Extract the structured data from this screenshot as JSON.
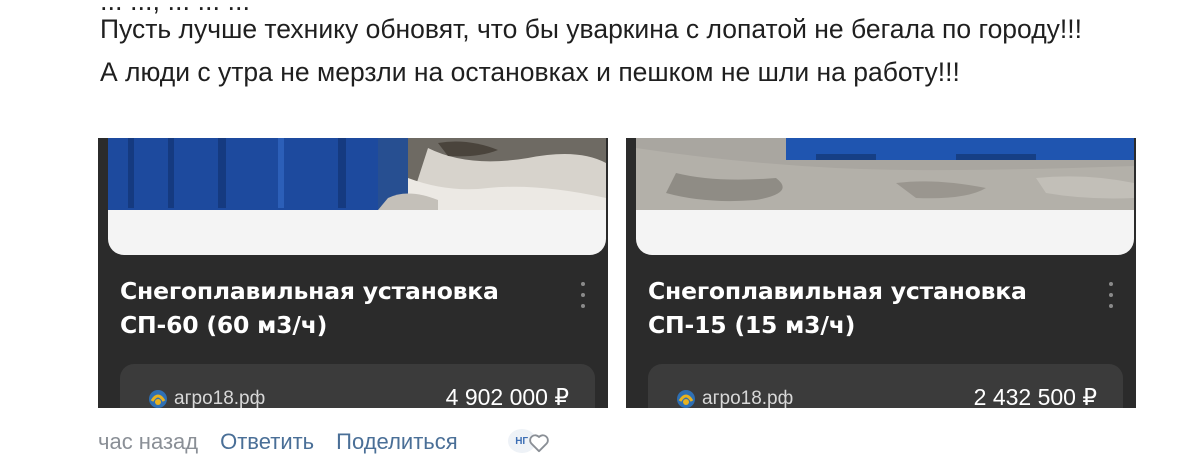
{
  "comment": {
    "cut_line": "... ..., ... ... ...",
    "text": "Пусть лучше технику обновят, что бы уваркина с лопатой не бегала по городу!!! А люди с утра не мерзли на остановках и пешком не шли на работу!!!"
  },
  "ads": [
    {
      "title": "Снегоплавильная установка СП-60 (60 м3/ч)",
      "site": "агро18.рф",
      "price": "4 902 000 ₽"
    },
    {
      "title": "Снегоплавильная установка СП-15 (15 м3/ч)",
      "site": "агро18.рф",
      "price": "2 432 500 ₽"
    }
  ],
  "actions": {
    "time": "час назад",
    "reply": "Ответить",
    "share": "Поделиться",
    "badge": "НГ"
  },
  "icons": {
    "menu": "more-vertical-icon",
    "like": "heart-icon",
    "site_logo": "site-logo-icon"
  },
  "colors": {
    "card_bg": "#2b2b2b",
    "price_bg": "#3b3b3b",
    "link": "#4a6f97",
    "muted": "#8a8f96",
    "container_blue": "#1d4a9e"
  }
}
